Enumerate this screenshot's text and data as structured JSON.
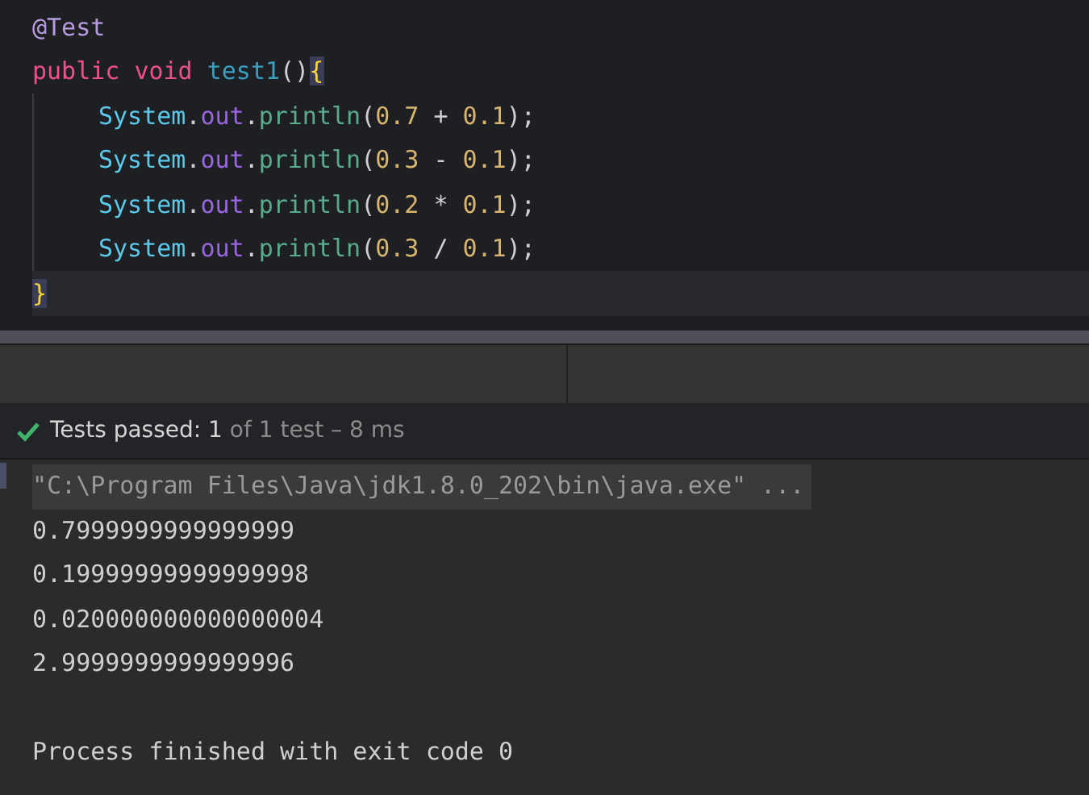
{
  "editor": {
    "lines": [
      {
        "current": false,
        "tokens": [
          {
            "kind": "annotation",
            "text": "@Test"
          }
        ]
      },
      {
        "current": false,
        "tokens": [
          {
            "kind": "keyword",
            "text": "public void"
          },
          {
            "kind": "method",
            "text": "test1",
            "space_before": true
          },
          {
            "kind": "plain",
            "text": "()"
          },
          {
            "kind": "brace",
            "text": "{"
          }
        ],
        "children": [
          {
            "current": false,
            "tokens": [
              {
                "kind": "class",
                "text": "System"
              },
              {
                "kind": "plain",
                "text": "."
              },
              {
                "kind": "field",
                "text": "out"
              },
              {
                "kind": "plain",
                "text": "."
              },
              {
                "kind": "call",
                "text": "println"
              },
              {
                "kind": "plain",
                "text": "("
              },
              {
                "kind": "number",
                "text": "0.7"
              },
              {
                "kind": "plain",
                "text": "+",
                "space_before": true
              },
              {
                "kind": "number",
                "text": "0.1",
                "space_before": true
              },
              {
                "kind": "plain",
                "text": ");"
              }
            ]
          },
          {
            "current": false,
            "tokens": [
              {
                "kind": "class",
                "text": "System"
              },
              {
                "kind": "plain",
                "text": "."
              },
              {
                "kind": "field",
                "text": "out"
              },
              {
                "kind": "plain",
                "text": "."
              },
              {
                "kind": "call",
                "text": "println"
              },
              {
                "kind": "plain",
                "text": "("
              },
              {
                "kind": "number",
                "text": "0.3"
              },
              {
                "kind": "plain",
                "text": "-",
                "space_before": true
              },
              {
                "kind": "number",
                "text": "0.1",
                "space_before": true
              },
              {
                "kind": "plain",
                "text": ");"
              }
            ]
          },
          {
            "current": false,
            "tokens": [
              {
                "kind": "class",
                "text": "System"
              },
              {
                "kind": "plain",
                "text": "."
              },
              {
                "kind": "field",
                "text": "out"
              },
              {
                "kind": "plain",
                "text": "."
              },
              {
                "kind": "call",
                "text": "println"
              },
              {
                "kind": "plain",
                "text": "("
              },
              {
                "kind": "number",
                "text": "0.2"
              },
              {
                "kind": "plain",
                "text": "*",
                "space_before": true
              },
              {
                "kind": "number",
                "text": "0.1",
                "space_before": true
              },
              {
                "kind": "plain",
                "text": ");"
              }
            ]
          },
          {
            "current": false,
            "tokens": [
              {
                "kind": "class",
                "text": "System"
              },
              {
                "kind": "plain",
                "text": "."
              },
              {
                "kind": "field",
                "text": "out"
              },
              {
                "kind": "plain",
                "text": "."
              },
              {
                "kind": "call",
                "text": "println"
              },
              {
                "kind": "plain",
                "text": "("
              },
              {
                "kind": "number",
                "text": "0.3"
              },
              {
                "kind": "plain",
                "text": "/",
                "space_before": true
              },
              {
                "kind": "number",
                "text": "0.1",
                "space_before": true
              },
              {
                "kind": "plain",
                "text": ");"
              }
            ]
          }
        ]
      },
      {
        "current": true,
        "tokens": [
          {
            "kind": "brace",
            "text": "}"
          }
        ]
      }
    ]
  },
  "test_status": {
    "passed": true,
    "label": "Tests passed:",
    "count": "1",
    "detail": "of 1 test – 8 ms"
  },
  "console": {
    "lines": [
      {
        "kind": "command",
        "text": "\"C:\\Program Files\\Java\\jdk1.8.0_202\\bin\\java.exe\" ..."
      },
      {
        "kind": "output",
        "text": "0.7999999999999999"
      },
      {
        "kind": "output",
        "text": "0.19999999999999998"
      },
      {
        "kind": "output",
        "text": "0.020000000000000004"
      },
      {
        "kind": "output",
        "text": "2.9999999999999996"
      },
      {
        "kind": "exit",
        "text": "Process finished with exit code 0"
      }
    ]
  }
}
